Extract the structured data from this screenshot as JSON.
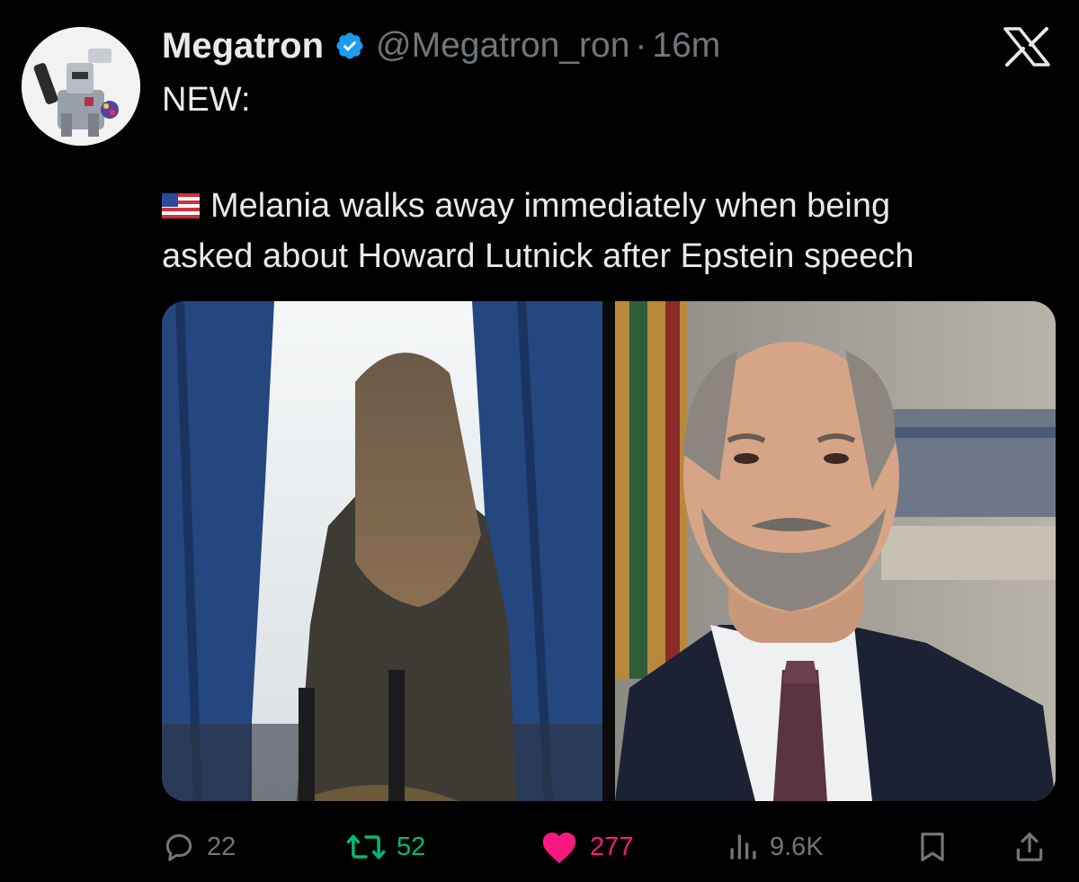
{
  "tweet": {
    "author": {
      "display_name": "Megatron",
      "handle": "@Megatron_ron",
      "verified": true,
      "avatar": "megatron-avatar"
    },
    "separator": "·",
    "time": "16m",
    "text_line_1": "NEW:",
    "text_line_2": "Melania walks away immediately when being",
    "text_line_3": "asked about Howard Lutnick after Epstein speech",
    "flag_icon": "us-flag-icon",
    "media": [
      "woman-walking-away-photo",
      "man-portrait-photo"
    ],
    "stats": {
      "replies": "22",
      "retweets": "52",
      "likes": "277",
      "views": "9.6K"
    }
  },
  "app": {
    "logo_icon": "x-logo-icon"
  },
  "colors": {
    "background": "#000000",
    "text": "#e7e9ea",
    "secondary": "#71767b",
    "verified": "#1d9bf0",
    "retweet": "#00ba7c",
    "like": "#f91880"
  }
}
